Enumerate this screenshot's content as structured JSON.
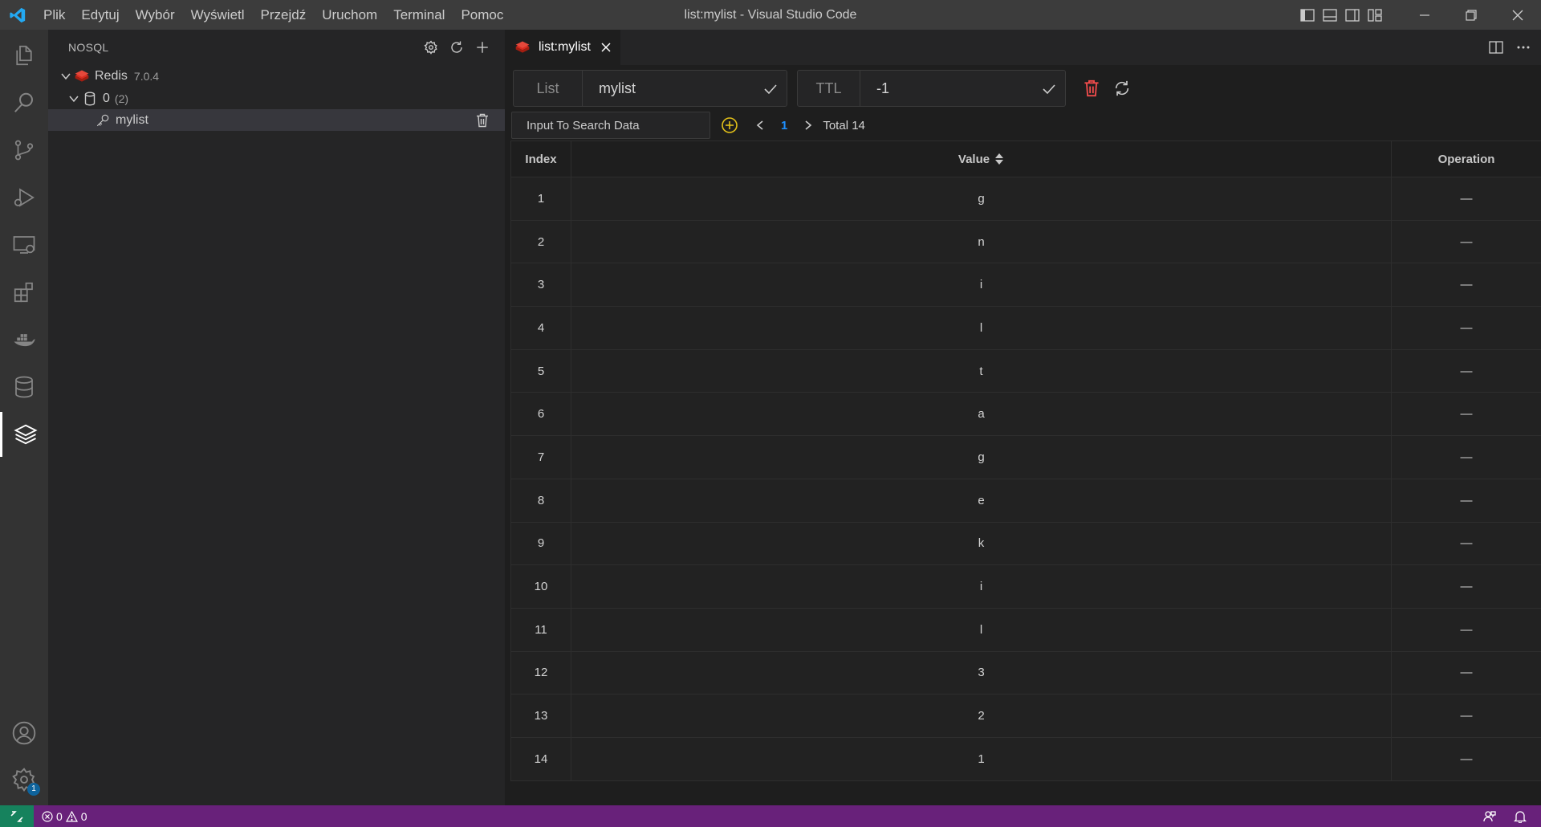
{
  "titlebar": {
    "menu": [
      "Plik",
      "Edytuj",
      "Wybór",
      "Wyświetl",
      "Przejdź",
      "Uruchom",
      "Terminal",
      "Pomoc"
    ],
    "title": "list:mylist - Visual Studio Code"
  },
  "activitybar": {
    "icons": [
      "explorer-icon",
      "search-icon",
      "source-control-icon",
      "run-debug-icon",
      "remote-explorer-icon",
      "extensions-icon",
      "docker-icon",
      "database-icon",
      "nosql-icon"
    ],
    "bottom_icons": [
      "account-icon",
      "settings-gear-icon"
    ],
    "settings_badge": "1"
  },
  "sidebar": {
    "title": "NOSQL",
    "tree": {
      "connection": {
        "label": "Redis",
        "version": "7.0.4"
      },
      "database": {
        "label": "0",
        "count": "(2)"
      },
      "key": {
        "label": "mylist"
      }
    }
  },
  "tab": {
    "label": "list:mylist"
  },
  "keybar": {
    "type_label": "List",
    "key_name": "mylist",
    "ttl_label": "TTL",
    "ttl_value": "-1"
  },
  "search": {
    "placeholder": "Input To Search Data",
    "current_page": "1",
    "total_label": "Total 14"
  },
  "table": {
    "headers": {
      "index": "Index",
      "value": "Value",
      "operation": "Operation"
    },
    "rows": [
      {
        "index": "1",
        "value": "g",
        "op": "—"
      },
      {
        "index": "2",
        "value": "n",
        "op": "—"
      },
      {
        "index": "3",
        "value": "i",
        "op": "—"
      },
      {
        "index": "4",
        "value": "l",
        "op": "—"
      },
      {
        "index": "5",
        "value": "t",
        "op": "—"
      },
      {
        "index": "6",
        "value": "a",
        "op": "—"
      },
      {
        "index": "7",
        "value": "g",
        "op": "—"
      },
      {
        "index": "8",
        "value": "e",
        "op": "—"
      },
      {
        "index": "9",
        "value": "k",
        "op": "—"
      },
      {
        "index": "10",
        "value": "i",
        "op": "—"
      },
      {
        "index": "11",
        "value": "l",
        "op": "—"
      },
      {
        "index": "12",
        "value": "3",
        "op": "—"
      },
      {
        "index": "13",
        "value": "2",
        "op": "—"
      },
      {
        "index": "14",
        "value": "1",
        "op": "—"
      }
    ]
  },
  "statusbar": {
    "errors": "0",
    "warnings": "0"
  },
  "colors": {
    "accent": "#0e639c",
    "statusbar": "#68217a",
    "remote": "#16825d",
    "redis_red": "#d82c20",
    "add_yellow": "#e2c019",
    "delete_red": "#f14c4c",
    "page_blue": "#1e90ff"
  }
}
